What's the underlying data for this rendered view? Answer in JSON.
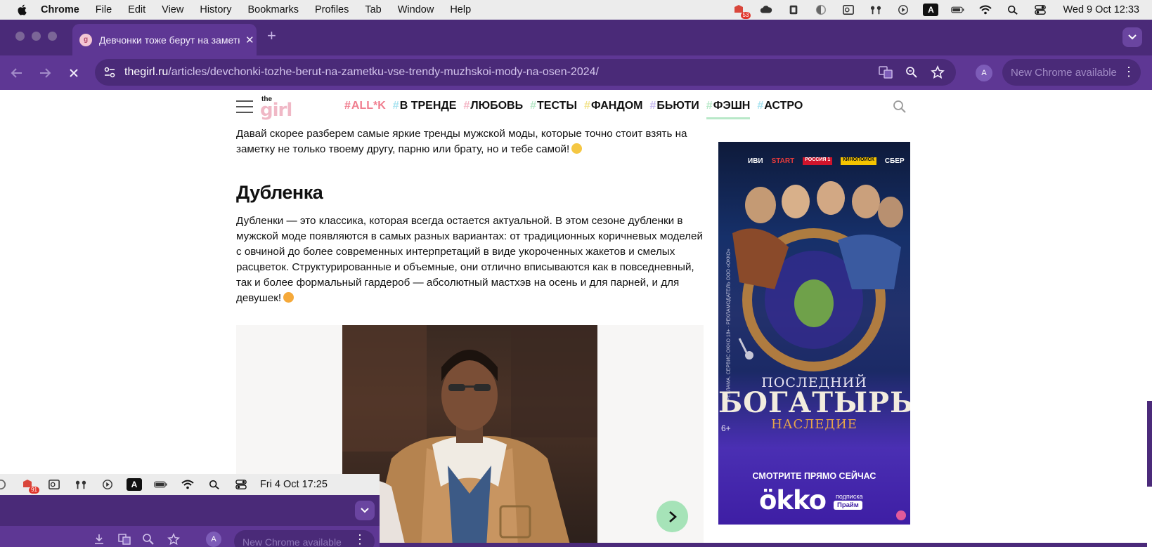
{
  "menubar": {
    "app": "Chrome",
    "items": [
      "File",
      "Edit",
      "View",
      "History",
      "Bookmarks",
      "Profiles",
      "Tab",
      "Window",
      "Help"
    ],
    "badge_count": "53",
    "input_indicator": "A",
    "datetime": "Wed 9 Oct  12:33"
  },
  "browser": {
    "tab_title": "Девчонки тоже берут на заметку",
    "tab_favicon_letter": "g",
    "url_host": "thegirl.ru",
    "url_path": "/articles/devchonki-tozhe-berut-na-zametku-vse-trendy-muzhskoi-mody-na-osen-2024/",
    "profile_initial": "A",
    "update_label": "New Chrome available"
  },
  "site": {
    "logo_top": "the",
    "logo_main": "girl",
    "nav": [
      {
        "hash": "#",
        "label": "ALL*K",
        "color": "#f07e8f"
      },
      {
        "hash": "#",
        "label": "В ТРЕНДЕ",
        "color": "#111111"
      },
      {
        "hash": "#",
        "label": "ЛЮБОВЬ",
        "color": "#111111"
      },
      {
        "hash": "#",
        "label": "ТЕСТЫ",
        "color": "#111111"
      },
      {
        "hash": "#",
        "label": "ФАНДОМ",
        "color": "#111111"
      },
      {
        "hash": "#",
        "label": "БЬЮТИ",
        "color": "#111111"
      },
      {
        "hash": "#",
        "label": "ФЭШН",
        "color": "#111111"
      },
      {
        "hash": "#",
        "label": "АСТРО",
        "color": "#111111"
      }
    ],
    "hash_colors": [
      "#f07e8f",
      "#a9e3f0",
      "#f4b7c6",
      "#b8e8c8",
      "#f2e38c",
      "#c6b8f0",
      "#b8e8c8",
      "#a9e3f0"
    ],
    "active_nav_index": 6
  },
  "article": {
    "intro": "Давай скорее разберем самые яркие тренды мужской моды, которые точно стоит взять на заметку не только твоему другу, парню или брату, но и тебе самой!",
    "heading": "Дубленка",
    "body": "Дубленки — это классика, которая всегда остается актуальной. В этом сезоне дубленки в мужской моде появляются в самых разных вариантах: от традиционных коричневых моделей с овчиной до более современных интерпретаций в виде укороченных жакетов и смелых расцветок. Структурированные и объемные, они отлично вписываются как в повседневный, так и более формальный гардероб — абсолютный мастхэв на осень и для парней, и для девушек!"
  },
  "ad": {
    "partners": [
      "ИВИ",
      "START",
      "РОССИЯ 1",
      "КИНОПОИСК",
      "СБЕР"
    ],
    "disclaimer": "РЕКЛАМА. СЕРВИС OKKO 18+ · РЕКЛАМОДАТЕЛЬ ООО «ОККО»",
    "title_top": "ПОСЛЕДНИЙ",
    "title_main": "БОГАТЫРЬ",
    "title_sub": "НАСЛЕДИЕ",
    "age": "6+",
    "cta": "СМОТРИТЕ ПРЯМО СЕЙЧАС",
    "brand": "ökko",
    "brand_sub": "подписка",
    "brand_tier": "Прайм"
  },
  "overlay_window": {
    "badge_count": "91",
    "input_indicator": "A",
    "datetime": "Fri 4 Oct  17:25",
    "update_label": "New Chrome available",
    "profile_initial": "A"
  }
}
